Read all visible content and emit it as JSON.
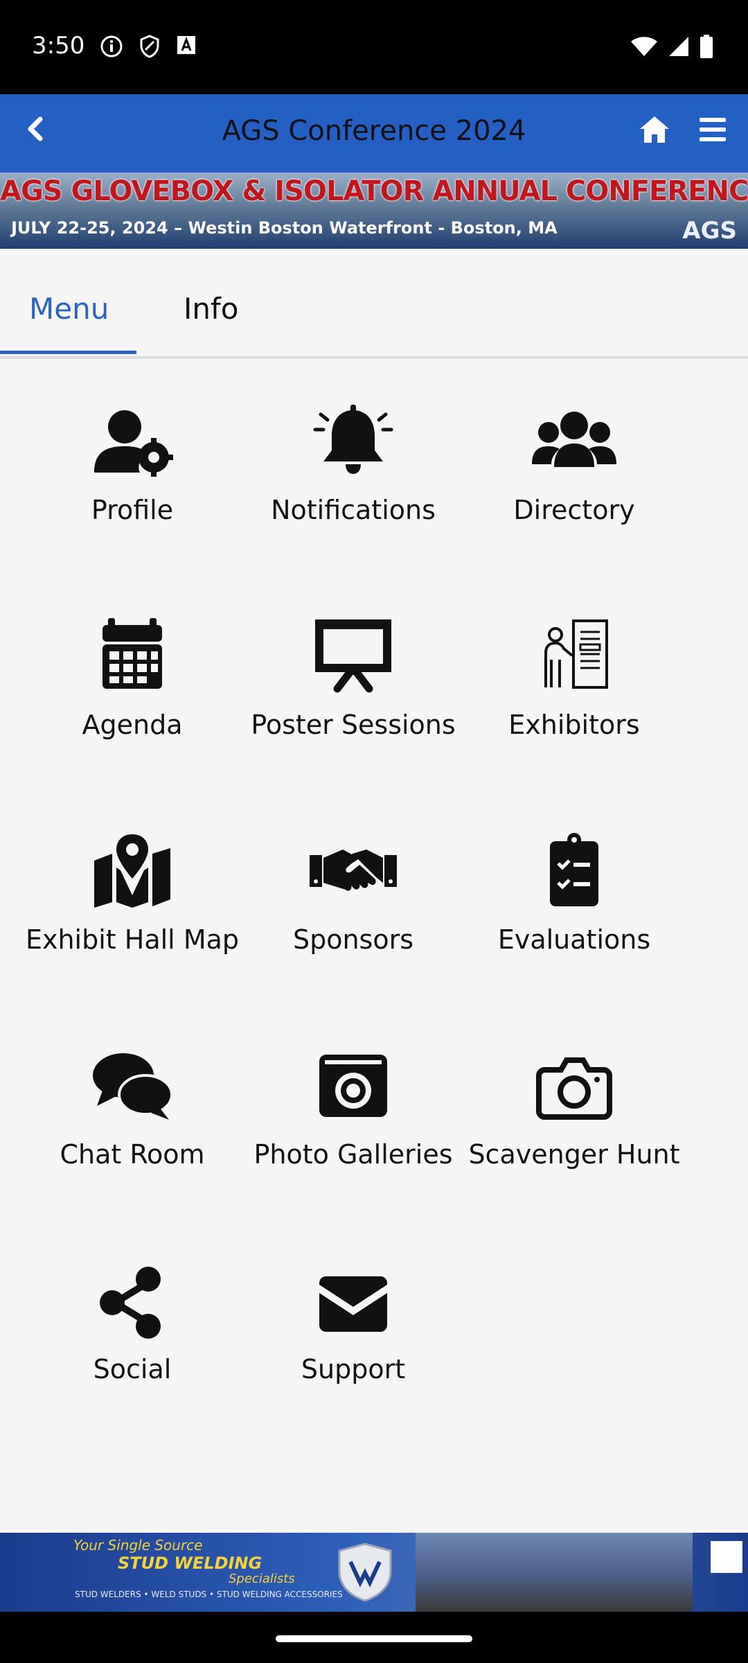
{
  "status_bar": {
    "time": "3:50"
  },
  "header": {
    "title": "AGS Conference 2024"
  },
  "banner_top": {
    "line1": "AGS GLOVEBOX & ISOLATOR ANNUAL CONFERENCE & EXPO",
    "line2": "JULY 22-25, 2024 – Westin Boston Waterfront - Boston, MA",
    "logo": "AGS"
  },
  "tabs": [
    {
      "label": "Menu",
      "active": true
    },
    {
      "label": "Info",
      "active": false
    }
  ],
  "menu_items": [
    {
      "label": "Profile",
      "icon": "user-gear-icon"
    },
    {
      "label": "Notifications",
      "icon": "bell-icon"
    },
    {
      "label": "Directory",
      "icon": "users-icon"
    },
    {
      "label": "Agenda",
      "icon": "calendar-icon"
    },
    {
      "label": "Poster Sessions",
      "icon": "presentation-icon"
    },
    {
      "label": "Exhibitors",
      "icon": "exhibitor-booth-icon"
    },
    {
      "label": "Exhibit Hall Map",
      "icon": "map-pin-icon"
    },
    {
      "label": "Sponsors",
      "icon": "handshake-icon"
    },
    {
      "label": "Evaluations",
      "icon": "clipboard-check-icon"
    },
    {
      "label": "Chat Room",
      "icon": "chat-icon"
    },
    {
      "label": "Photo Galleries",
      "icon": "photo-camera-icon"
    },
    {
      "label": "Scavenger Hunt",
      "icon": "camera-icon"
    },
    {
      "label": "Social",
      "icon": "share-icon"
    },
    {
      "label": "Support",
      "icon": "envelope-icon"
    }
  ],
  "banner_bottom": {
    "line1": "Your Single Source",
    "line2": "STUD WELDING",
    "line3": "Specialists",
    "line4": "STUD WELDERS • WELD STUDS • STUD WELDING ACCESSORIES"
  },
  "colors": {
    "header_bg": "#2460c4",
    "accent": "#2b63c4"
  }
}
